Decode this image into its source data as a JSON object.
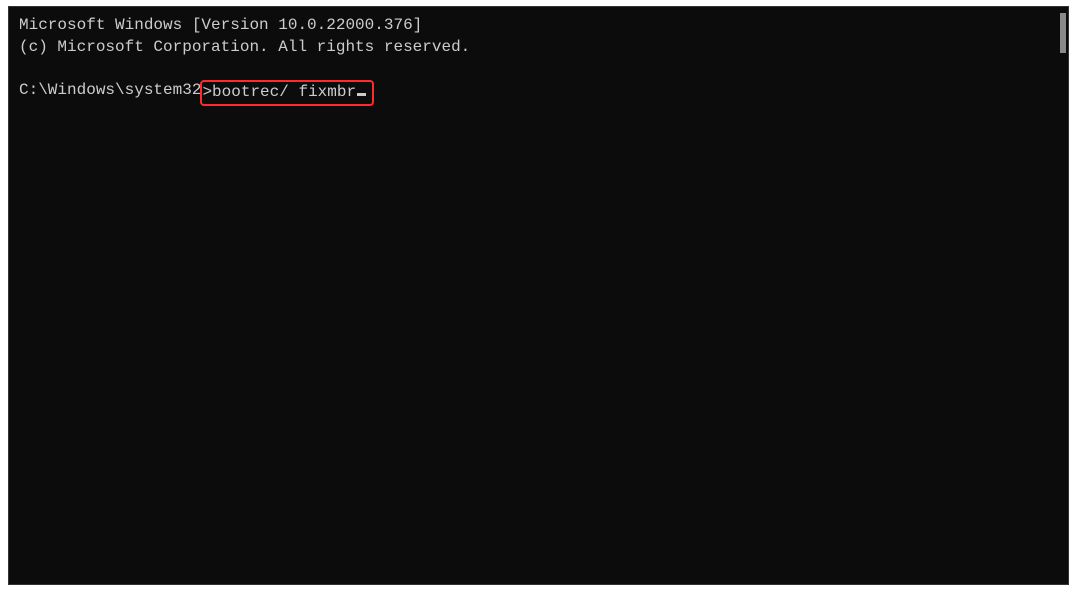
{
  "terminal": {
    "header_line1": "Microsoft Windows [Version 10.0.22000.376]",
    "header_line2": "(c) Microsoft Corporation. All rights reserved.",
    "prompt_path": "C:\\Windows\\system32",
    "prompt_symbol": ">",
    "command": "bootrec/ fixmbr"
  }
}
